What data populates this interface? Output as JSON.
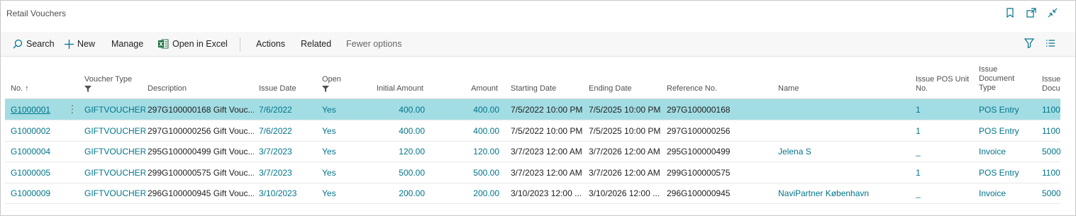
{
  "window": {
    "title": "Retail Vouchers",
    "icons": [
      "bookmark-icon",
      "open-new-window-icon",
      "collapse-icon"
    ]
  },
  "actions": {
    "search": "Search",
    "new": "New",
    "manage": "Manage",
    "open_excel": "Open in Excel",
    "actions": "Actions",
    "related": "Related",
    "fewer_options": "Fewer options"
  },
  "columns": {
    "no": "No. ↑",
    "voucher_type": "Voucher Type",
    "description": "Description",
    "issue_date": "Issue Date",
    "open": "Open",
    "initial_amount": "Initial Amount",
    "amount": "Amount",
    "starting_date": "Starting Date",
    "ending_date": "Ending Date",
    "reference_no": "Reference No.",
    "name": "Name",
    "issue_pos_unit_l1": "Issue POS Unit",
    "issue_pos_unit_l2": "No.",
    "issue_doc_type_l1": "Issue",
    "issue_doc_type_l2": "Document",
    "issue_doc_type_l3": "Type",
    "issue_doc_l1": "Issue",
    "issue_doc_l2": "Docum"
  },
  "rows": [
    {
      "no": "G1000001",
      "voucher_type": "GIFTVOUCHER",
      "description": "297G100000168 Gift Vouc...",
      "issue_date": "7/6/2022",
      "open": "Yes",
      "initial_amount": "400.00",
      "amount": "400.00",
      "starting_date": "7/5/2022 10:00 PM",
      "ending_date": "7/5/2025 10:00 PM",
      "reference_no": "297G100000168",
      "name": "",
      "issue_pos_unit": "1",
      "issue_doc_type": "POS Entry",
      "issue_doc": "1100",
      "selected": true
    },
    {
      "no": "G1000002",
      "voucher_type": "GIFTVOUCHER",
      "description": "297G100000256 Gift Vouc...",
      "issue_date": "7/6/2022",
      "open": "Yes",
      "initial_amount": "400.00",
      "amount": "400.00",
      "starting_date": "7/5/2022 10:00 PM",
      "ending_date": "7/5/2025 10:00 PM",
      "reference_no": "297G100000256",
      "name": "",
      "issue_pos_unit": "1",
      "issue_doc_type": "POS Entry",
      "issue_doc": "1100",
      "selected": false
    },
    {
      "no": "G1000004",
      "voucher_type": "GIFTVOUCHER",
      "description": "295G100000499 Gift Vouc...",
      "issue_date": "3/7/2023",
      "open": "Yes",
      "initial_amount": "120.00",
      "amount": "120.00",
      "starting_date": "3/7/2023 12:00 AM",
      "ending_date": "3/7/2026 12:00 AM",
      "reference_no": "295G100000499",
      "name": "Jelena S",
      "issue_pos_unit": "_",
      "issue_doc_type": "Invoice",
      "issue_doc": "5000",
      "selected": false
    },
    {
      "no": "G1000005",
      "voucher_type": "GIFTVOUCHER",
      "description": "299G100000575 Gift Vouc...",
      "issue_date": "3/7/2023",
      "open": "Yes",
      "initial_amount": "500.00",
      "amount": "500.00",
      "starting_date": "3/7/2023 12:00 AM",
      "ending_date": "3/7/2026 12:00 AM",
      "reference_no": "299G100000575",
      "name": "",
      "issue_pos_unit": "1",
      "issue_doc_type": "POS Entry",
      "issue_doc": "1100",
      "selected": false
    },
    {
      "no": "G1000009",
      "voucher_type": "GIFTVOUCHER",
      "description": "296G100000945 Gift Vouc...",
      "issue_date": "3/10/2023",
      "open": "Yes",
      "initial_amount": "200.00",
      "amount": "200.00",
      "starting_date": "3/10/2023 12:00 ...",
      "ending_date": "3/10/2026 12:00 ...",
      "reference_no": "296G100000945",
      "name": "NaviPartner København",
      "issue_pos_unit": "_",
      "issue_doc_type": "Invoice",
      "issue_doc": "5000",
      "selected": false
    }
  ],
  "colors": {
    "link": "#00758a",
    "selected_row": "#a3dde4",
    "excel": "#1d6f42"
  }
}
